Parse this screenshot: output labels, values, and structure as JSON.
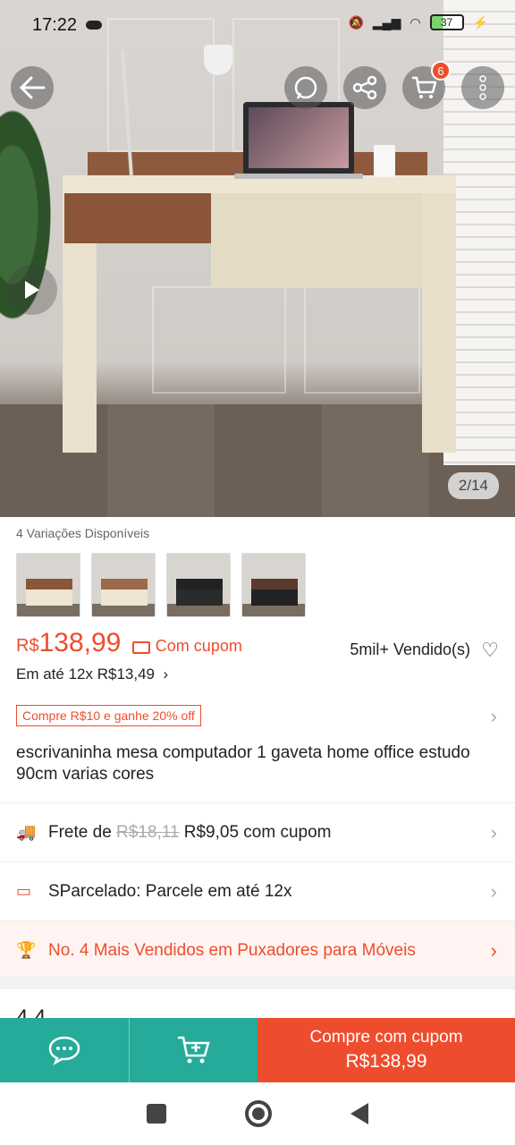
{
  "status_bar": {
    "time": "17:22",
    "battery": "37"
  },
  "gallery": {
    "counter": "2/14"
  },
  "header": {
    "cart_count": "6"
  },
  "product": {
    "variations_label": "4 Variações Disponíveis",
    "currency": "R$",
    "price": "138,99",
    "coupon_label": "Com cupom",
    "sold": "5mil+ Vendido(s)",
    "installments": "Em até 12x R$13,49",
    "promo": "Compre R$10 e ganhe 20% off",
    "title": "escrivaninha mesa computador 1 gaveta home office estudo 90cm varias cores"
  },
  "shipping": {
    "prefix": "Frete de",
    "old_price": "R$18,11",
    "new_price": "R$9,05 com cupom"
  },
  "installment_row": {
    "text": "SParcelado: Parcele em até 12x"
  },
  "ranking": {
    "text": "No. 4 Mais Vendidos em Puxadores para Móveis"
  },
  "rating_peek": {
    "text": "4.4"
  },
  "bottom_bar": {
    "buy_label": "Compre com cupom",
    "buy_price": "R$138,99"
  },
  "colors": {
    "accent": "#ee4d2d",
    "teal": "#26aa99"
  },
  "thumbs": [
    {
      "desk": "#8a5538",
      "leg": "#eee6d3"
    },
    {
      "desk": "#9a6a4a",
      "leg": "#eee6d3"
    },
    {
      "desk": "#222222",
      "leg": "#2b2b2b"
    },
    {
      "desk": "#5a3a2a",
      "leg": "#222222"
    }
  ]
}
